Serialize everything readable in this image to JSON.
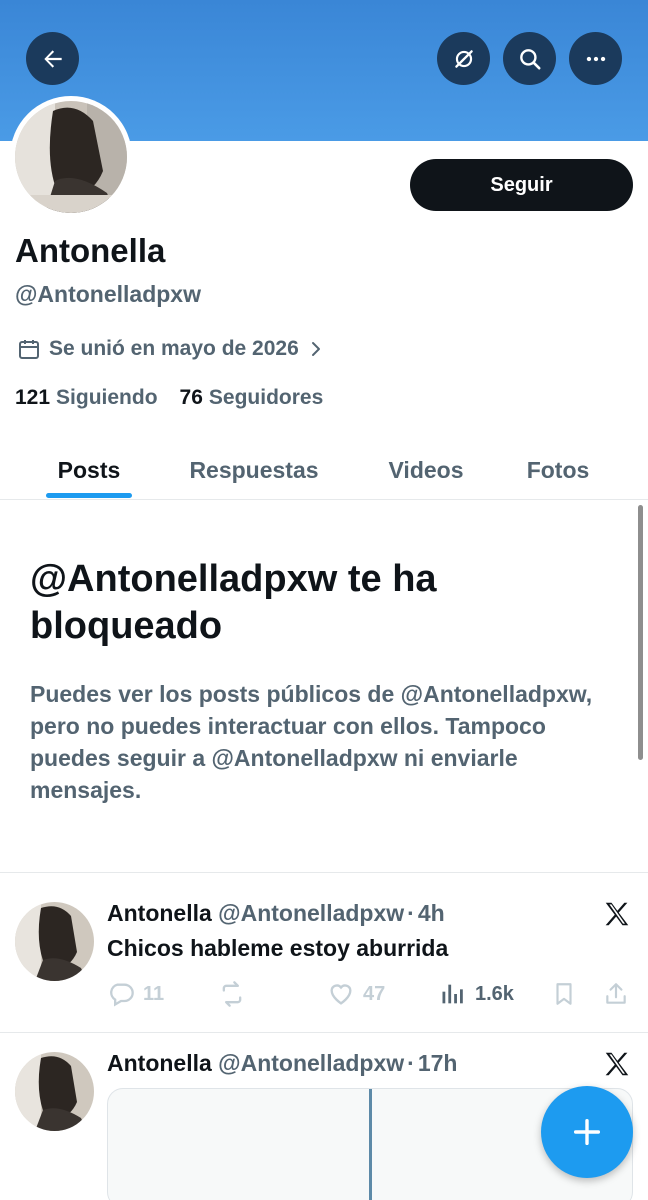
{
  "profile": {
    "display_name": "Antonella",
    "handle": "@Antonelladpxw",
    "joined": "Se unió en mayo de 2026",
    "following_count": "121",
    "following_label": "Siguiendo",
    "followers_count": "76",
    "followers_label": "Seguidores",
    "follow_label": "Seguir"
  },
  "tabs": [
    {
      "label": "Posts",
      "active": true
    },
    {
      "label": "Respuestas",
      "active": false
    },
    {
      "label": "Videos",
      "active": false
    },
    {
      "label": "Fotos",
      "active": false
    }
  ],
  "blocked": {
    "title": "@Antonelladpxw te ha bloqueado",
    "body": "Puedes ver los posts públicos de @Antonelladpxw, pero no puedes interactuar con ellos. Tampoco puedes seguir a @Antonelladpxw ni enviarle mensajes."
  },
  "posts": [
    {
      "name": "Antonella",
      "handle": "@Antonelladpxw",
      "separator": "·",
      "time": "4h",
      "text": "Chicos hableme estoy aburrida",
      "replies": "11",
      "likes": "47",
      "views": "1.6k"
    },
    {
      "name": "Antonella",
      "handle": "@Antonelladpxw",
      "separator": "·",
      "time": "17h"
    }
  ],
  "icons": {
    "back": "arrow-left-icon",
    "translate": "no-translate-icon",
    "search": "search-icon",
    "more": "more-icon",
    "calendar": "calendar-icon",
    "chevron": "chevron-right-icon",
    "reply": "reply-icon",
    "repost": "repost-icon",
    "like": "heart-icon",
    "views": "views-icon",
    "bookmark": "bookmark-icon",
    "share": "share-icon",
    "x": "x-logo-icon",
    "compose": "plus-icon"
  },
  "colors": {
    "banner": "#4a9be6",
    "accent": "#1d9bf0",
    "primary_text": "#0f1419",
    "secondary_text": "#536471",
    "follow_button": "#0f1419"
  }
}
